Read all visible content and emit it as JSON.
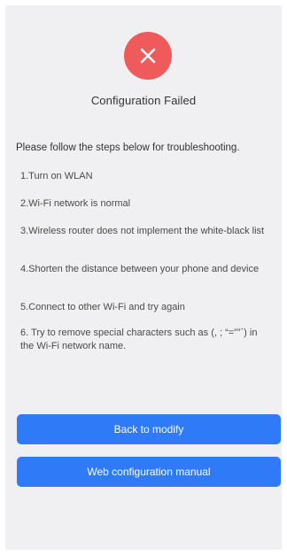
{
  "status": {
    "icon": "close-icon",
    "title": "Configuration Failed"
  },
  "troubleshooting": {
    "intro": "Please follow the steps below for troubleshooting.",
    "steps": [
      "1.Turn on WLAN",
      "2.Wi-Fi network is normal",
      "3.Wireless router does not implement the white-black list",
      "4.Shorten the distance between your phone and device",
      "5.Connect to other Wi-Fi and try again",
      "6. Try to remove special characters such as (, ; “=””`) in the Wi-Fi network name."
    ]
  },
  "actions": {
    "back_label": "Back to modify",
    "web_config_label": "Web configuration manual"
  },
  "colors": {
    "error": "#ef5a5a",
    "primary": "#2f7af6",
    "background": "#f0f0f2"
  }
}
